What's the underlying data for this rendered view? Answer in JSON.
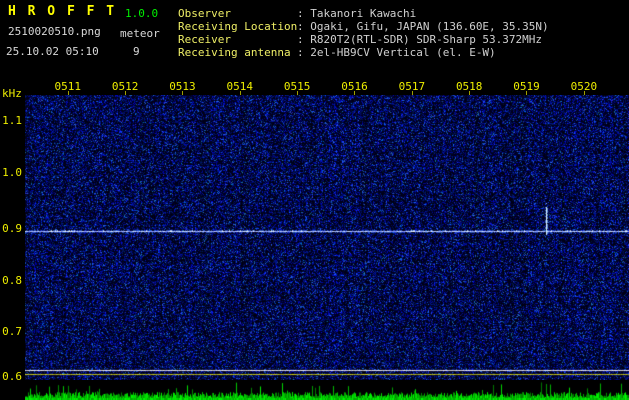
{
  "app": {
    "title": "H R O F F T",
    "version": "1.0.0",
    "filename": "2510020510.png",
    "mode": "meteor",
    "datetime": "25.10.02 05:10",
    "count": "9"
  },
  "info": {
    "rows": [
      {
        "label": "Observer",
        "value": "Takanori Kawachi"
      },
      {
        "label": "Receiving Location",
        "value": "Ogaki, Gifu, JAPAN (136.60E, 35.35N)"
      },
      {
        "label": "Receiver",
        "value": "R820T2(RTL-SDR) SDR-Sharp 53.372MHz"
      },
      {
        "label": "Receiving antenna",
        "value": "2el-HB9CV Vertical (el. E-W)"
      }
    ]
  },
  "spectrogram": {
    "unit": "kHz",
    "y_ticks": [
      "1.1",
      "1.0",
      "0.9",
      "0.8",
      "0.7",
      "0.6"
    ],
    "x_ticks": [
      "0511",
      "0512",
      "0513",
      "0514",
      "0515",
      "0516",
      "0517",
      "0518",
      "0519",
      "0520"
    ],
    "carrier_freq_khz": 0.9,
    "echo_time_label": "0519"
  },
  "colors": {
    "accent_yellow": "#ffff00",
    "accent_green": "#00ee00",
    "text_white": "#d8d8d8",
    "noise_blue": "#2020c0",
    "carrier_line": "#e8f4ff",
    "strip_green": "#00cc00"
  }
}
